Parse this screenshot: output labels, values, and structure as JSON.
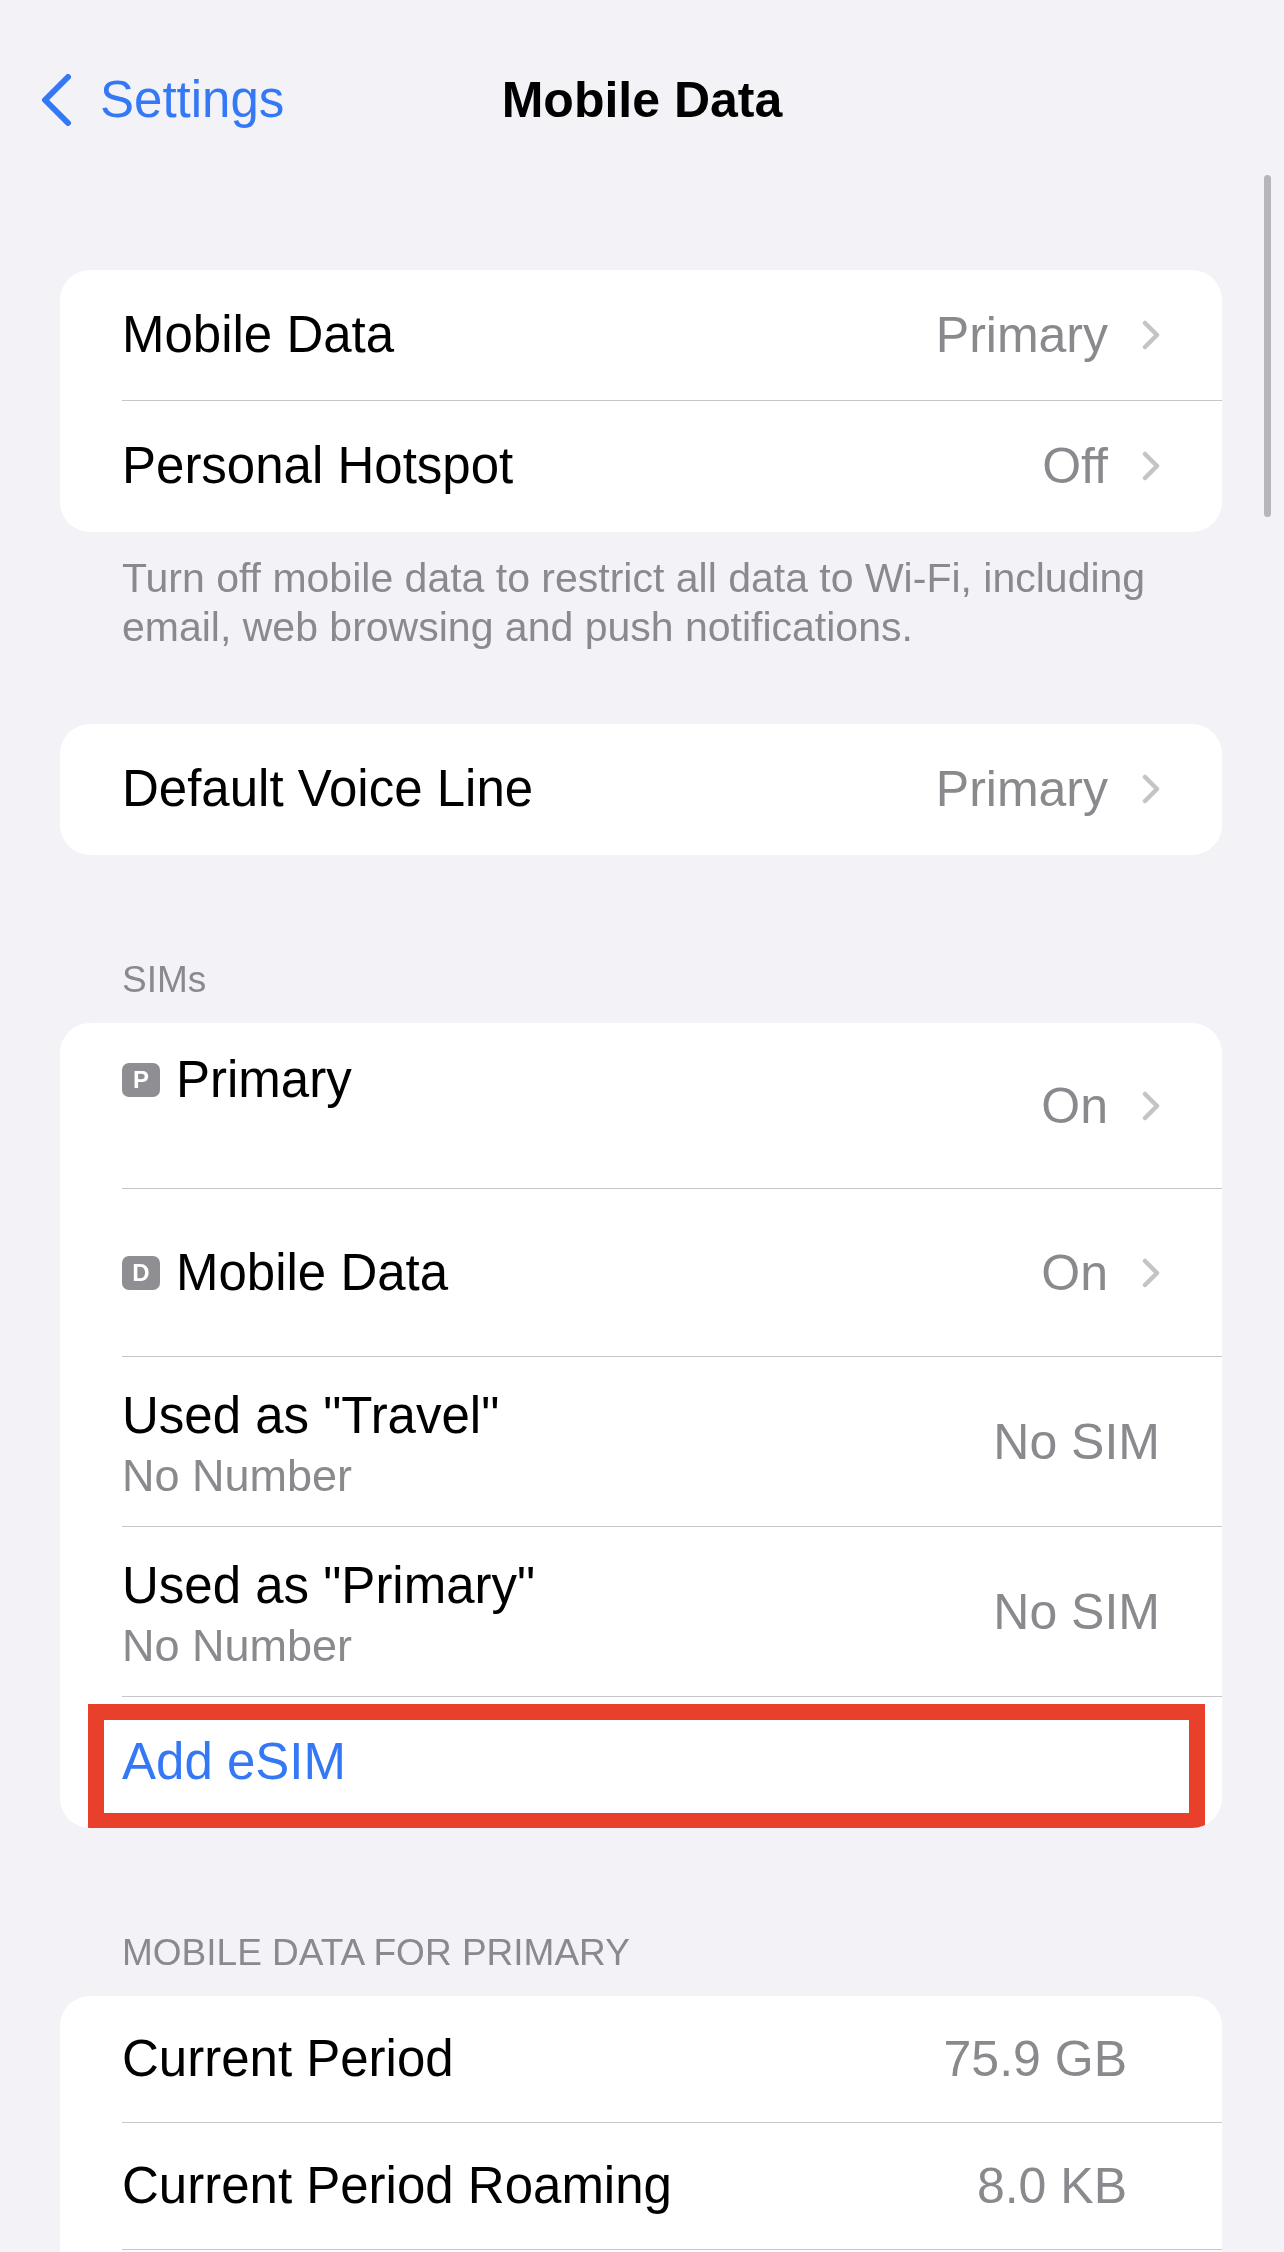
{
  "nav_bar": {
    "back_button": {
      "label": "Settings"
    },
    "title": "Mobile Data"
  },
  "sections": [
    {
      "rows": [
        {
          "kind": "nav",
          "label": "Mobile Data",
          "value": "Primary",
          "highlighted": false
        },
        {
          "kind": "nav",
          "label": "Personal Hotspot",
          "value": "Off",
          "highlighted": false
        }
      ],
      "footer": "Turn off mobile data to restrict all data to Wi-Fi, including email, web browsing and push notifications."
    },
    {
      "rows": [
        {
          "kind": "nav",
          "label": "Default Voice Line",
          "value": "Primary",
          "highlighted": false
        }
      ]
    },
    {
      "header": "SIMs",
      "rows": [
        {
          "kind": "simline",
          "badge": "P",
          "label": "Primary",
          "value": "On",
          "highlighted": false
        },
        {
          "kind": "simdata",
          "badge": "D",
          "label": "Mobile Data",
          "value": "On",
          "highlighted": false
        },
        {
          "kind": "number",
          "label": "Used as \"Travel\"",
          "subtitle": "No Number",
          "value": "No SIM",
          "highlighted": false
        },
        {
          "kind": "number",
          "label": "Used as \"Primary\"",
          "subtitle": "No Number",
          "value": "No SIM",
          "highlighted": false
        },
        {
          "kind": "action",
          "label": "Add eSIM",
          "highlighted": true
        }
      ]
    },
    {
      "header": "MOBILE DATA FOR PRIMARY",
      "rows": [
        {
          "kind": "stat",
          "label": "Current Period",
          "value": "75.9 GB",
          "highlighted": false
        },
        {
          "kind": "stat",
          "label": "Current Period Roaming",
          "value": "8.0 KB",
          "highlighted": false
        }
      ]
    }
  ]
}
